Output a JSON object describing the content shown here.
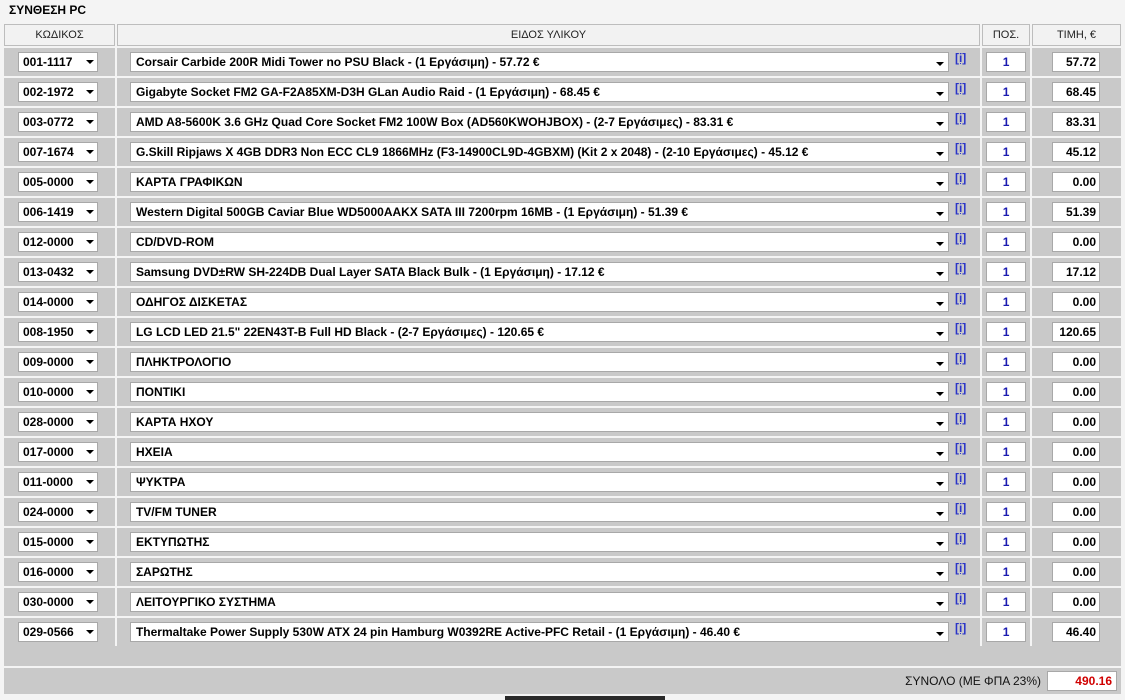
{
  "title": "ΣΥΝΘΕΣΗ PC",
  "headers": {
    "code": "ΚΩΔΙΚΟΣ",
    "description": "ΕΙΔΟΣ ΥΛΙΚΟΥ",
    "quantity": "ΠΟΣ.",
    "price": "ΤΙΜΗ, €"
  },
  "info_label": "[i]",
  "rows": [
    {
      "code": "001-1117",
      "description": "Corsair Carbide 200R Midi Tower no PSU Black - (1 Εργάσιμη) - 57.72 €",
      "qty": "1",
      "price": "57.72"
    },
    {
      "code": "002-1972",
      "description": "Gigabyte Socket FM2 GA-F2A85XM-D3H GLan Audio Raid - (1 Εργάσιμη) - 68.45 €",
      "qty": "1",
      "price": "68.45"
    },
    {
      "code": "003-0772",
      "description": "AMD A8-5600K 3.6 GHz Quad Core Socket FM2 100W Box (AD560KWOHJBOX) - (2-7 Εργάσιμες) - 83.31 €",
      "qty": "1",
      "price": "83.31"
    },
    {
      "code": "007-1674",
      "description": "G.Skill Ripjaws X 4GB DDR3 Non ECC CL9 1866MHz (F3-14900CL9D-4GBXM) (Kit 2 x 2048) - (2-10 Εργάσιμες) - 45.12 €",
      "qty": "1",
      "price": "45.12"
    },
    {
      "code": "005-0000",
      "description": "ΚΑΡΤΑ ΓΡΑΦΙΚΩΝ",
      "qty": "1",
      "price": "0.00"
    },
    {
      "code": "006-1419",
      "description": "Western Digital 500GB Caviar Blue WD5000AAKX SATA III 7200rpm 16MB - (1 Εργάσιμη) - 51.39 €",
      "qty": "1",
      "price": "51.39"
    },
    {
      "code": "012-0000",
      "description": "CD/DVD-ROM",
      "qty": "1",
      "price": "0.00"
    },
    {
      "code": "013-0432",
      "description": "Samsung DVD±RW SH-224DB Dual Layer SATA Black Bulk - (1 Εργάσιμη) - 17.12 €",
      "qty": "1",
      "price": "17.12"
    },
    {
      "code": "014-0000",
      "description": "ΟΔΗΓΟΣ ΔΙΣΚΕΤΑΣ",
      "qty": "1",
      "price": "0.00"
    },
    {
      "code": "008-1950",
      "description": "LG LCD LED 21.5\" 22EN43T-B Full HD Black - (2-7 Εργάσιμες) - 120.65 €",
      "qty": "1",
      "price": "120.65"
    },
    {
      "code": "009-0000",
      "description": "ΠΛΗΚΤΡΟΛΟΓΙΟ",
      "qty": "1",
      "price": "0.00"
    },
    {
      "code": "010-0000",
      "description": "ΠΟΝΤΙΚΙ",
      "qty": "1",
      "price": "0.00"
    },
    {
      "code": "028-0000",
      "description": "ΚΑΡΤΑ ΗΧΟΥ",
      "qty": "1",
      "price": "0.00"
    },
    {
      "code": "017-0000",
      "description": "ΗΧΕΙΑ",
      "qty": "1",
      "price": "0.00"
    },
    {
      "code": "011-0000",
      "description": "ΨΥΚΤΡΑ",
      "qty": "1",
      "price": "0.00"
    },
    {
      "code": "024-0000",
      "description": "TV/FM TUNER",
      "qty": "1",
      "price": "0.00"
    },
    {
      "code": "015-0000",
      "description": "ΕΚΤΥΠΩΤΗΣ",
      "qty": "1",
      "price": "0.00"
    },
    {
      "code": "016-0000",
      "description": "ΣΑΡΩΤΗΣ",
      "qty": "1",
      "price": "0.00"
    },
    {
      "code": "030-0000",
      "description": "ΛΕΙΤΟΥΡΓΙΚΟ ΣΥΣΤΗΜΑ",
      "qty": "1",
      "price": "0.00"
    },
    {
      "code": "029-0566",
      "description": "Thermaltake Power Supply 530W ATX 24 pin Hamburg W0392RE Active-PFC Retail - (1 Εργάσιμη) - 46.40 €",
      "qty": "1",
      "price": "46.40"
    }
  ],
  "total": {
    "label": "ΣΥΝΟΛΟ (ΜΕ ΦΠΑ 23%)",
    "value": "490.16"
  },
  "colors": {
    "row_bg": "#c9c9c9",
    "info_link": "#2b35c8",
    "quantity_text": "#1a1ab0",
    "total_value": "#d00000"
  },
  "icons": {
    "dropdown": "chevron-down-icon",
    "info": "info-icon"
  }
}
